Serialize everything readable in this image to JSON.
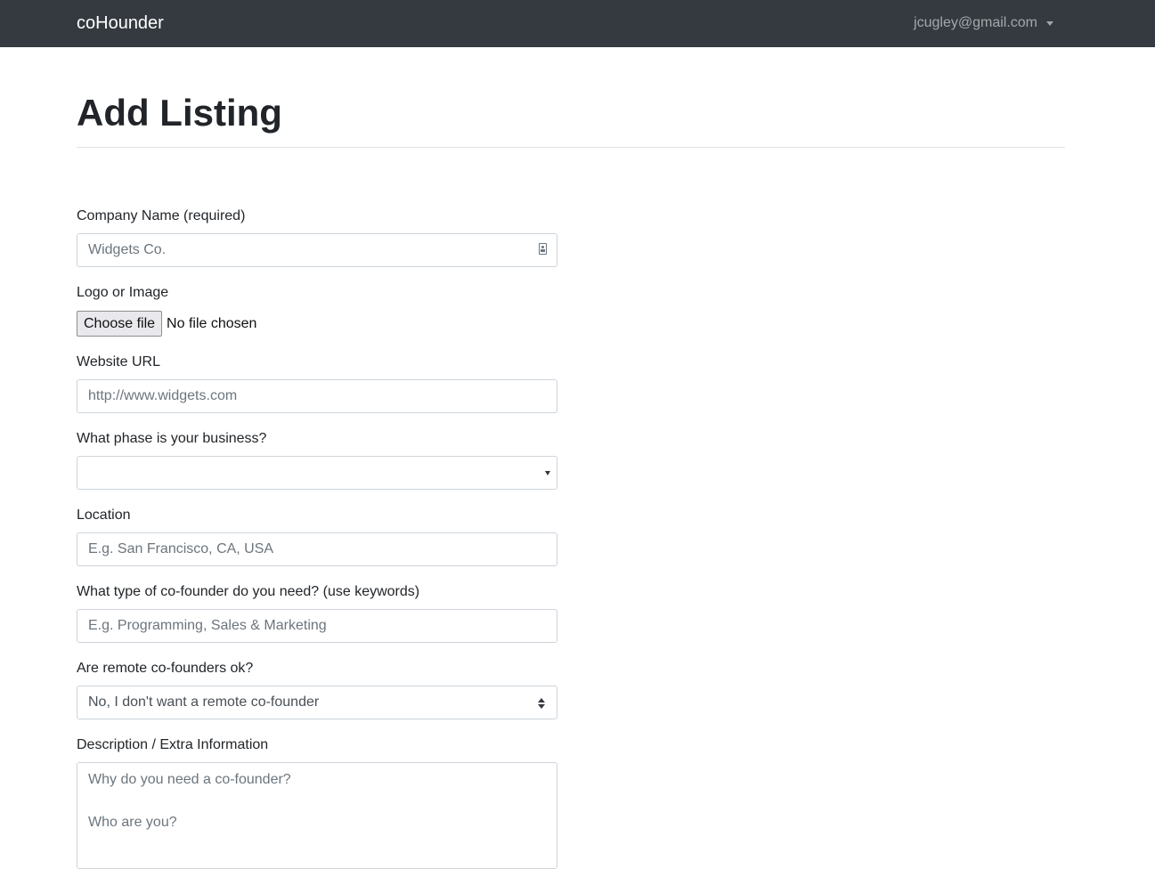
{
  "navbar": {
    "brand": "coHounder",
    "user_email": "jcugley@gmail.com"
  },
  "page": {
    "title": "Add Listing"
  },
  "form": {
    "company_name": {
      "label": "Company Name (required)",
      "placeholder": "Widgets Co.",
      "icon": "contact-card-icon"
    },
    "logo": {
      "label": "Logo or Image",
      "button_label": "Choose file",
      "status": "No file chosen"
    },
    "website": {
      "label": "Website URL",
      "placeholder": "http://www.widgets.com"
    },
    "phase": {
      "label": "What phase is your business?",
      "selected": ""
    },
    "location": {
      "label": "Location",
      "placeholder": "E.g. San Francisco, CA, USA"
    },
    "cofounder_type": {
      "label": "What type of co-founder do you need? (use keywords)",
      "placeholder": "E.g. Programming, Sales & Marketing"
    },
    "remote": {
      "label": "Are remote co-founders ok?",
      "selected": "No, I don't want a remote co-founder"
    },
    "description": {
      "label": "Description / Extra Information",
      "placeholder": "Why do you need a co-founder?\n\nWho are you?"
    }
  }
}
